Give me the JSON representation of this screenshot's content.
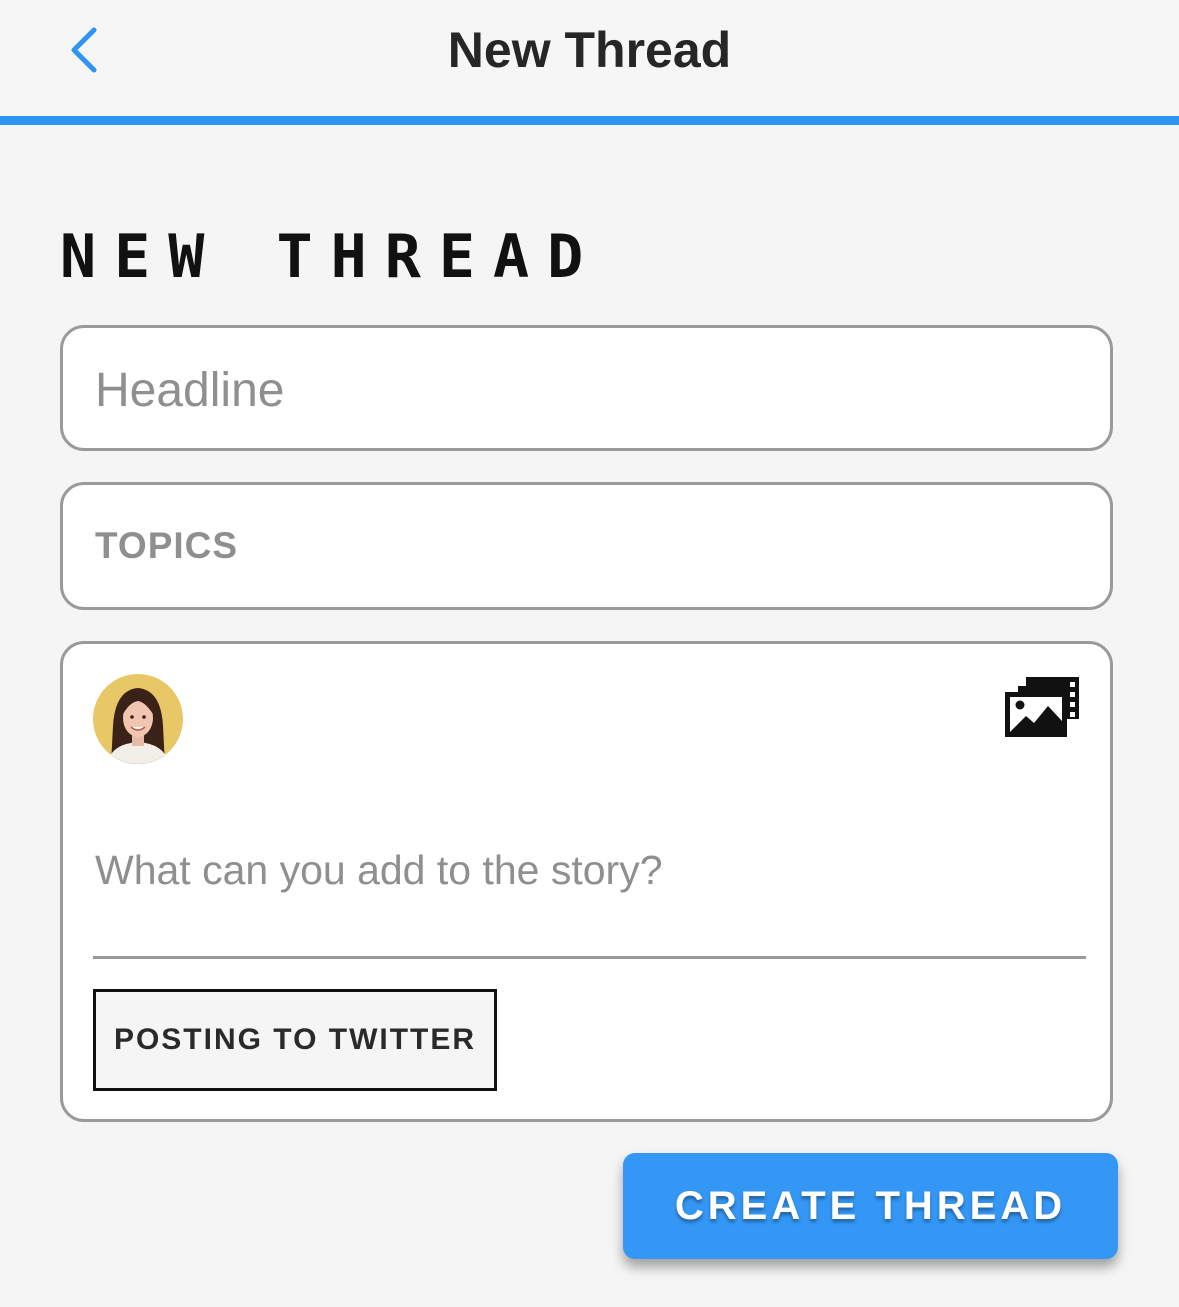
{
  "nav": {
    "title": "New Thread",
    "back_icon": "chevron-left-icon",
    "accent_color": "#2e95f2"
  },
  "page": {
    "heading": "NEW THREAD"
  },
  "form": {
    "headline_placeholder": "Headline",
    "topics_placeholder": "TOPICS",
    "story_placeholder": "What can you add to the story?",
    "media_icon": "photo-gallery-icon",
    "twitter_toggle_label": "POSTING TO TWITTER"
  },
  "actions": {
    "create_label": "CREATE THREAD",
    "create_color": "#3497f5"
  }
}
